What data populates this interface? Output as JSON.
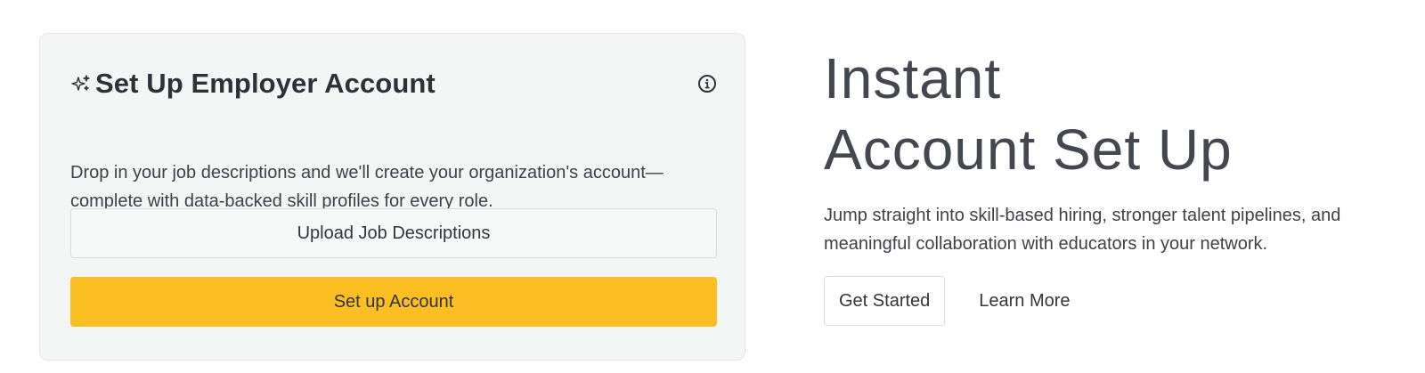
{
  "card": {
    "title": "Set Up Employer Account",
    "title_icon": "sparkle-icon",
    "info_icon": "info-icon",
    "description": "Drop in your job descriptions and we'll create your organization's account—complete with data-backed skill profiles for every role.",
    "upload_button": "Upload Job Descriptions",
    "setup_button": "Set up Account"
  },
  "hero": {
    "title_line1": "Instant",
    "title_line2": "Account Set Up",
    "subtitle": "Jump straight into skill-based hiring, stronger talent pipelines, and meaningful collaboration with educators in your network.",
    "get_started": "Get Started",
    "learn_more": "Learn More"
  },
  "colors": {
    "primary_button": "#fbbf24",
    "card_background": "#f4f5f5",
    "text": "#3f4148"
  }
}
